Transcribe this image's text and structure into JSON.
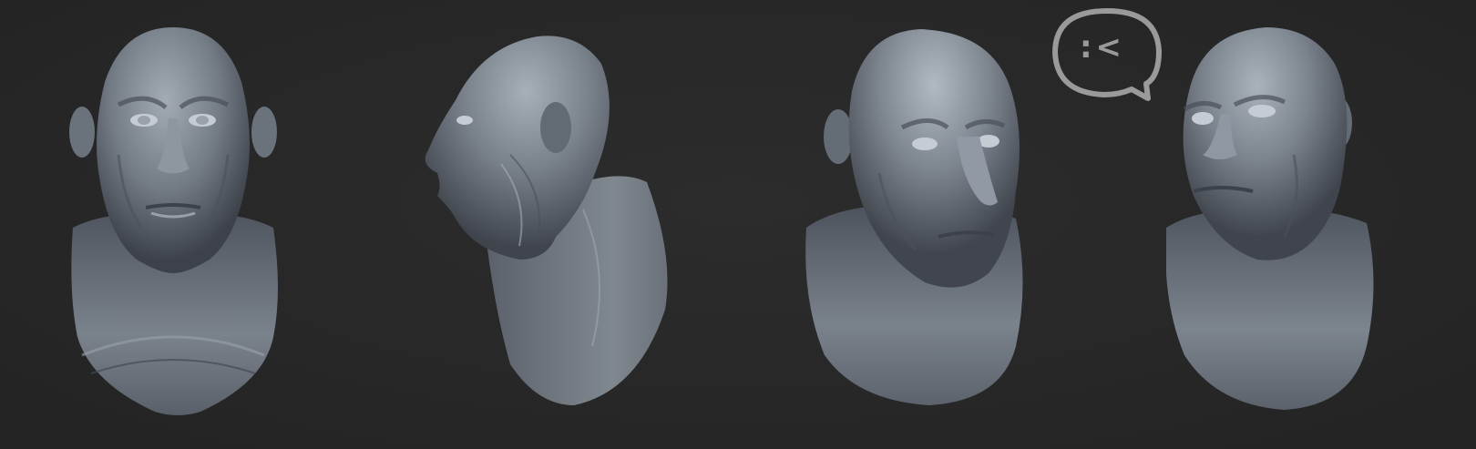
{
  "scene": {
    "background_color": "#282828",
    "clay_color": "#8a929c",
    "clay_shadow_color": "#3c4148",
    "clay_highlight_color": "#b8c0ca"
  },
  "views": [
    {
      "name": "front"
    },
    {
      "name": "profile-left"
    },
    {
      "name": "three-quarter-left"
    },
    {
      "name": "three-quarter-right"
    }
  ],
  "speech_bubble": {
    "text": ":<",
    "stroke_color": "#9a9a9a"
  }
}
